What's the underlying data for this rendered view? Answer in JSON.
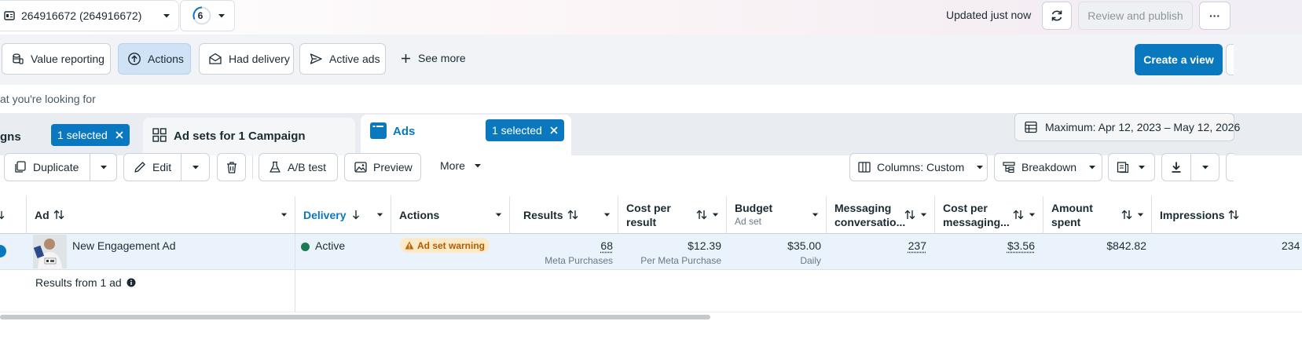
{
  "topbar": {
    "account_label": "264916672 (264916672)",
    "notification_count": "6",
    "updated_text": "Updated just now",
    "review_publish_label": "Review and publish",
    "more_label": "···"
  },
  "views": {
    "items": [
      {
        "label": "Value reporting"
      },
      {
        "label": "Actions"
      },
      {
        "label": "Had delivery"
      },
      {
        "label": "Active ads"
      }
    ],
    "see_more_label": "See more",
    "create_view_label": "Create a view"
  },
  "search": {
    "placeholder": "at you're looking for"
  },
  "level_tabs": {
    "campaigns_label": "gns",
    "campaigns_selected": "1 selected",
    "adsets_label": "Ad sets for 1 Campaign",
    "ads_label": "Ads",
    "ads_selected": "1 selected",
    "date_range": "Maximum: Apr 12, 2023 – May 12, 2026"
  },
  "toolbar": {
    "duplicate_label": "Duplicate",
    "edit_label": "Edit",
    "ab_test_label": "A/B test",
    "preview_label": "Preview",
    "more_label": "More",
    "columns_label": "Columns: Custom",
    "breakdown_label": "Breakdown"
  },
  "table": {
    "headers": {
      "ad": "Ad",
      "delivery": "Delivery",
      "actions": "Actions",
      "results": "Results",
      "cost_per_result_1": "Cost per",
      "cost_per_result_2": "result",
      "budget": "Budget",
      "budget_sub": "Ad set",
      "messaging_1": "Messaging",
      "messaging_2": "conversatio...",
      "cost_messaging_1": "Cost per",
      "cost_messaging_2": "messaging...",
      "amount_1": "Amount",
      "amount_2": "spent",
      "impressions": "Impressions"
    },
    "row": {
      "ad_name": "New Engagement Ad",
      "delivery": "Active",
      "actions_badge": "Ad set warning",
      "results": "68",
      "results_sub": "Meta Purchases",
      "cost_per_result": "$12.39",
      "cost_per_result_sub": "Per Meta Purchase",
      "budget": "$35.00",
      "budget_sub": "Daily",
      "messaging": "237",
      "cost_messaging": "$3.56",
      "amount_spent": "$842.82",
      "impressions": "234"
    },
    "summary": "Results from 1 ad"
  },
  "colors": {
    "accent": "#0a78be",
    "active_dot": "#1b7a54",
    "warning_bg": "#fde9c5",
    "warning_text": "#b25c00",
    "selected_view_bg": "#cfe2f6"
  }
}
